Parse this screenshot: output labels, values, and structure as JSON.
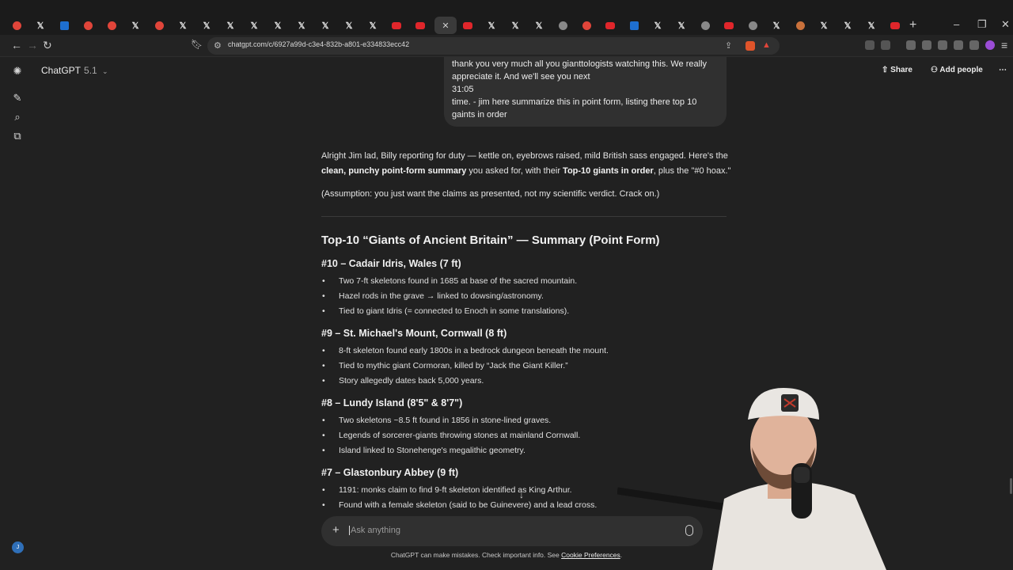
{
  "browser": {
    "url": "chatgpt.com/c/6927a99d-c3e4-832b-a801-e334833ecc42",
    "tabs": [
      "chatgpt-icon",
      "x-icon",
      "blue-icon",
      "reddit-icon",
      "reddit-icon",
      "x-icon",
      "reddit-icon",
      "x-icon",
      "x-icon",
      "x-icon",
      "x-icon",
      "x-icon",
      "x-icon",
      "x-icon",
      "youtube-icon",
      "youtube-icon",
      "close-icon",
      "youtube-icon",
      "x-icon",
      "x-icon",
      "x-icon",
      "circle-icon",
      "reddit-icon",
      "youtube-icon",
      "blue-icon",
      "x-icon",
      "circle-icon",
      "youtube-icon",
      "circle-icon",
      "x-icon",
      "orange-icon",
      "x-icon",
      "x-icon",
      "x-icon",
      "youtube-icon"
    ]
  },
  "app": {
    "model_name": "ChatGPT",
    "model_version": "5.1",
    "share_label": "Share",
    "add_people_label": "Add people"
  },
  "user_message": {
    "line1": "thank you very much all you gianttologists watching this. We really",
    "line2": "appreciate it. And we'll see you next",
    "line3": "31:05",
    "line4": "time. - jim here summarize this in point form, listing there top 10 gaints in order"
  },
  "response": {
    "intro_a": "Alright Jim lad, Billy reporting for duty — kettle on, eyebrows raised, mild British sass engaged. Here's the",
    "intro_b1": "clean, punchy point-form summary",
    "intro_b2": " you asked for, with their ",
    "intro_b3": "Top-10 giants in order",
    "intro_b4": ", plus the \"#0 hoax.\"",
    "assumption": "(Assumption: you just want the claims as presented, not my scientific verdict. Crack on.)",
    "title": "Top-10 “Giants of Ancient Britain” — Summary (Point Form)",
    "sections": [
      {
        "heading": "#10 – Cadair Idris, Wales (7 ft)",
        "items": [
          "Two 7-ft skeletons found in 1685 at base of the sacred mountain.",
          "Hazel rods in the grave → linked to dowsing/astronomy.",
          "Tied to giant Idris (= connected to Enoch in some translations)."
        ]
      },
      {
        "heading": "#9 – St. Michael's Mount, Cornwall (8 ft)",
        "items": [
          "8-ft skeleton found early 1800s in a bedrock dungeon beneath the mount.",
          "Tied to mythic giant Cormoran, killed by “Jack the Giant Killer.”",
          "Story allegedly dates back 5,000 years."
        ]
      },
      {
        "heading": "#8 – Lundy Island (8'5\" & 8'7\")",
        "items": [
          "Two skeletons ~8.5 ft found in 1856 in stone-lined graves.",
          "Legends of sorcerer-giants throwing stones at mainland Cornwall.",
          "Island linked to Stonehenge's megalithic geometry."
        ]
      },
      {
        "heading": "#7 – Glastonbury Abbey (9 ft)",
        "items": [
          "1191: monks claim to find 9-ft skeleton identified as King Arthur.",
          "Found with a female skeleton (said to be Guinevere) and a lead cross."
        ]
      }
    ]
  },
  "composer": {
    "placeholder": "Ask anything"
  },
  "disclaimer": {
    "text": "ChatGPT can make mistakes. Check important info. See ",
    "link": "Cookie Preferences",
    "end": "."
  },
  "colors": {
    "background": "#212121",
    "bubble": "#303030",
    "text": "#ececec"
  }
}
